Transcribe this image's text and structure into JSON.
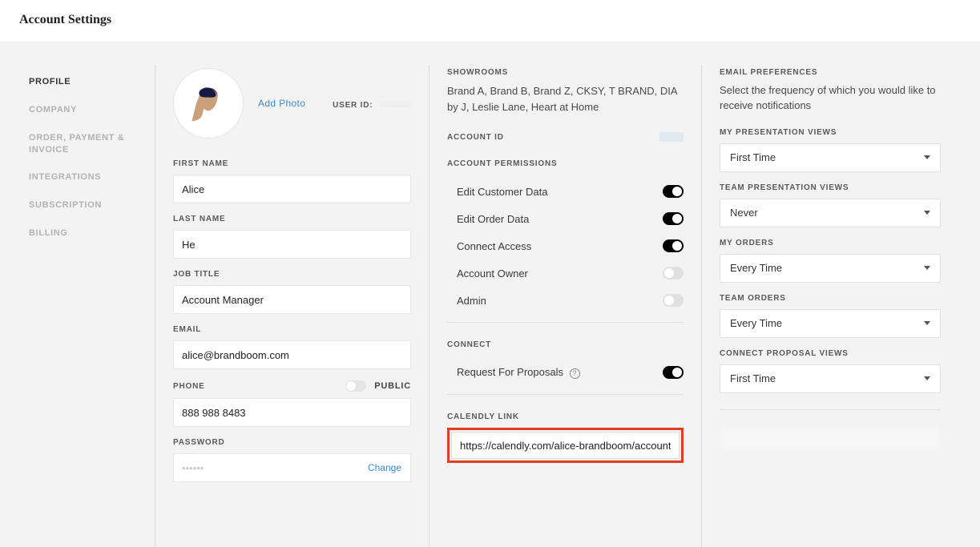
{
  "header": {
    "title": "Account Settings"
  },
  "sidebar": {
    "items": [
      {
        "label": "PROFILE",
        "active": true
      },
      {
        "label": "COMPANY"
      },
      {
        "label": "ORDER, PAYMENT & INVOICE"
      },
      {
        "label": "INTEGRATIONS"
      },
      {
        "label": "SUBSCRIPTION"
      },
      {
        "label": "BILLING"
      }
    ]
  },
  "profile": {
    "add_photo_label": "Add Photo",
    "user_id_label": "USER ID:",
    "first_name_label": "FIRST NAME",
    "first_name": "Alice",
    "last_name_label": "LAST NAME",
    "last_name": "He",
    "job_title_label": "JOB TITLE",
    "job_title": "Account Manager",
    "email_label": "EMAIL",
    "email": "alice@brandboom.com",
    "phone_label": "PHONE",
    "public_label": "Public",
    "phone": "888 988 8483",
    "password_label": "PASSWORD",
    "password_placeholder": "••••••",
    "change_label": "Change"
  },
  "account": {
    "showrooms_label": "SHOWROOMS",
    "showrooms_text": "Brand A, Brand B, Brand Z, CKSY, T BRAND, DIA by J, Leslie Lane, Heart at Home",
    "account_id_label": "ACCOUNT ID",
    "permissions_label": "ACCOUNT PERMISSIONS",
    "perms": [
      {
        "label": "Edit Customer Data",
        "on": true
      },
      {
        "label": "Edit Order Data",
        "on": true
      },
      {
        "label": "Connect Access",
        "on": true
      },
      {
        "label": "Account Owner",
        "on": false
      },
      {
        "label": "Admin",
        "on": false
      }
    ],
    "connect_label": "CONNECT",
    "connect_rfp_label": "Request For Proposals",
    "calendly_label": "CALENDLY LINK",
    "calendly_value": "https://calendly.com/alice-brandboom/account"
  },
  "prefs": {
    "header": "EMAIL PREFERENCES",
    "desc": "Select the frequency of which you would like to receive notifications",
    "groups": [
      {
        "label": "MY PRESENTATION VIEWS",
        "value": "First Time"
      },
      {
        "label": "TEAM PRESENTATION VIEWS",
        "value": "Never"
      },
      {
        "label": "MY ORDERS",
        "value": "Every Time"
      },
      {
        "label": "TEAM ORDERS",
        "value": "Every Time"
      },
      {
        "label": "CONNECT PROPOSAL VIEWS",
        "value": "First Time"
      }
    ]
  }
}
